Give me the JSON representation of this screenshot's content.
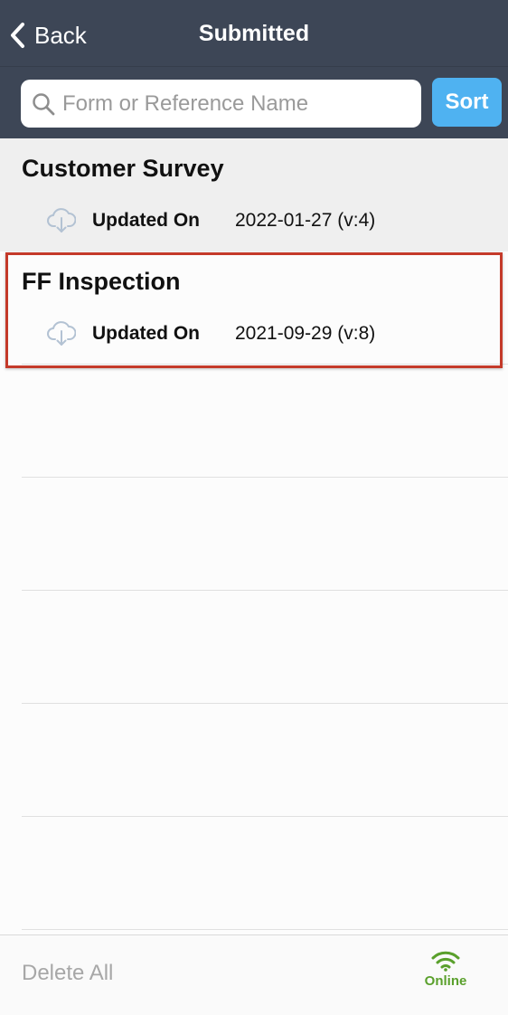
{
  "nav": {
    "back_label": "Back",
    "title": "Submitted"
  },
  "search": {
    "placeholder": "Form or Reference Name",
    "value": "",
    "sort_label": "Sort"
  },
  "forms": [
    {
      "name": "Customer Survey",
      "meta_label": "Updated On",
      "meta_value": "2022-01-27 (v:4)",
      "icon": "cloud-download-icon",
      "highlighted": false
    },
    {
      "name": "FF Inspection",
      "meta_label": "Updated On",
      "meta_value": "2021-09-29 (v:8)",
      "icon": "cloud-download-icon",
      "highlighted": true
    }
  ],
  "footer": {
    "delete_all_label": "Delete All",
    "status_label": "Online",
    "status_icon": "wifi-icon"
  },
  "colors": {
    "nav_bg": "#3d4656",
    "accent": "#4fb2f1",
    "online": "#5aa02c",
    "highlight_border": "#c43a2a"
  }
}
